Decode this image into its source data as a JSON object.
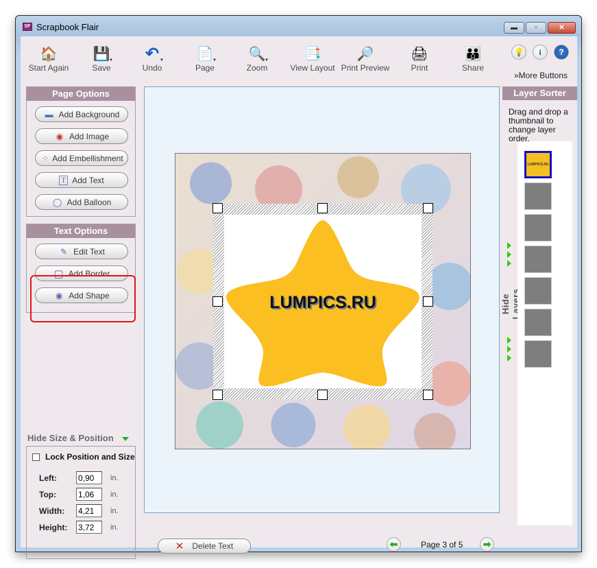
{
  "window": {
    "title": "Scrapbook Flair",
    "app_icon_text": "SF",
    "controls": {
      "minimize": "▬",
      "maximize": "▫",
      "close": "✕"
    }
  },
  "toolbar": {
    "items": [
      {
        "label": "Start Again",
        "icon": "house-icon",
        "glyph": "🏠",
        "dropdown": false
      },
      {
        "label": "Save",
        "icon": "floppy-disk-icon",
        "glyph": "💾",
        "dropdown": true
      },
      {
        "label": "Undo",
        "icon": "undo-arrow-icon",
        "glyph": "↶",
        "dropdown": true
      },
      {
        "label": "Page",
        "icon": "pages-icon",
        "glyph": "📄",
        "dropdown": true
      },
      {
        "label": "Zoom",
        "icon": "magnifier-icon",
        "glyph": "🔍",
        "dropdown": true
      },
      {
        "label": "View Layout",
        "icon": "view-layout-icon",
        "glyph": "📑",
        "dropdown": false
      },
      {
        "label": "Print Preview",
        "icon": "print-preview-icon",
        "glyph": "🔎",
        "dropdown": false
      },
      {
        "label": "Print",
        "icon": "printer-icon",
        "glyph": "🖨",
        "dropdown": false
      },
      {
        "label": "Share",
        "icon": "people-share-icon",
        "glyph": "👪",
        "dropdown": false
      }
    ],
    "dropdown_glyph": "▼",
    "help_icons": [
      {
        "name": "lightbulb-icon",
        "glyph": "💡"
      },
      {
        "name": "info-icon",
        "glyph": "i"
      },
      {
        "name": "help-icon",
        "glyph": "?"
      }
    ],
    "more_buttons": "»More Buttons"
  },
  "page_options": {
    "title": "Page Options",
    "buttons": [
      {
        "label": "Add Background",
        "icon": "background-icon",
        "glyph": "▬"
      },
      {
        "label": "Add Image",
        "icon": "image-icon",
        "glyph": "◉"
      },
      {
        "label": "Add Embellishment",
        "icon": "embellishment-icon",
        "glyph": "⁘"
      },
      {
        "label": "Add Text",
        "icon": "text-icon",
        "glyph": "T"
      },
      {
        "label": "Add Balloon",
        "icon": "balloon-icon",
        "glyph": "◯"
      }
    ]
  },
  "text_options": {
    "title": "Text Options",
    "buttons": [
      {
        "label": "Edit Text",
        "icon": "edit-text-icon",
        "glyph": "✎"
      },
      {
        "label": "Add Border",
        "icon": "border-icon",
        "glyph": "▢"
      },
      {
        "label": "Add Shape",
        "icon": "shape-icon",
        "glyph": "◉"
      }
    ]
  },
  "size_position": {
    "toggle_label": "Hide Size & Position",
    "lock_label": "Lock Position and Size",
    "lock_checked": false,
    "fields": [
      {
        "label": "Left:",
        "value": "0,90",
        "unit": "in."
      },
      {
        "label": "Top:",
        "value": "1,06",
        "unit": "in."
      },
      {
        "label": "Width:",
        "value": "4,21",
        "unit": "in."
      },
      {
        "label": "Height:",
        "value": "3,72",
        "unit": "in."
      }
    ]
  },
  "canvas": {
    "star_text": "LUMPICS.RU",
    "star_color": "#fbbf21"
  },
  "bottom": {
    "delete_label": "Delete Text",
    "delete_glyph": "✕",
    "prev_glyph": "⬅",
    "next_glyph": "➡",
    "page_label": "Page 3 of 5"
  },
  "layer_sorter": {
    "title": "Layer Sorter",
    "help": "Drag and drop a thumbnail to change layer order.",
    "hide_label": "Hide Layers",
    "active_thumb_text": "LUMPICS.RU",
    "thumb_count": 7
  },
  "colors": {
    "panel_header": "#a8909f",
    "highlight": "#e0151c",
    "active_layer_border": "#1010c8"
  }
}
